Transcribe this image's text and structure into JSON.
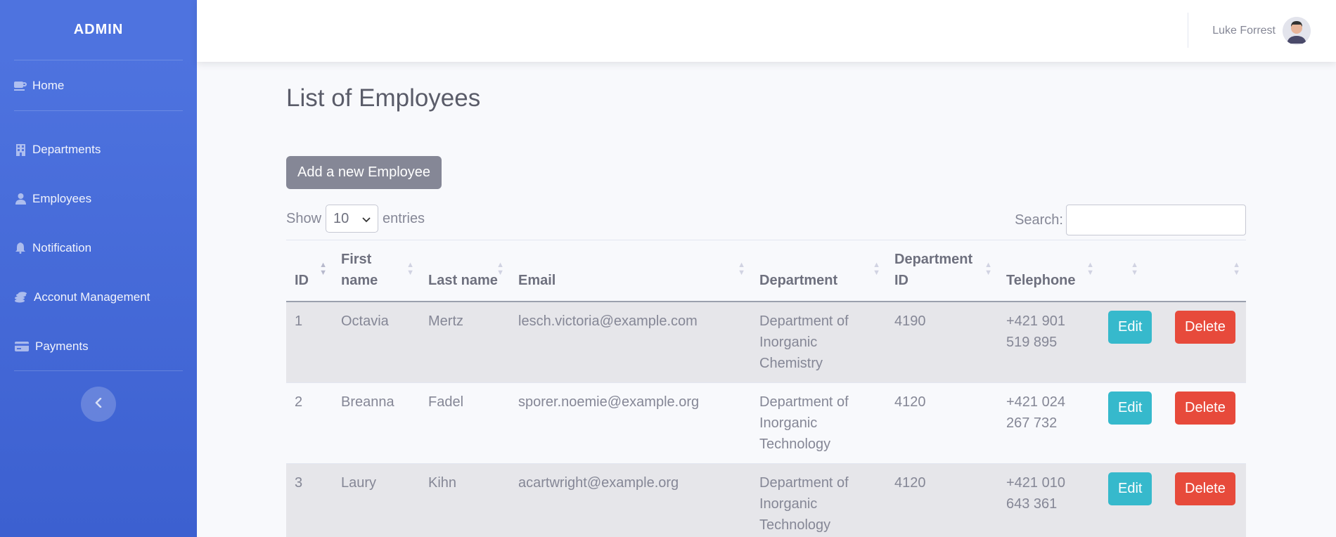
{
  "sidebar": {
    "brand": "ADMIN",
    "items": [
      {
        "label": "Home",
        "icon": "coffee-icon"
      },
      {
        "label": "Departments",
        "icon": "building-icon"
      },
      {
        "label": "Employees",
        "icon": "user-icon"
      },
      {
        "label": "Notification",
        "icon": "bell-icon"
      },
      {
        "label": "Acconut Management",
        "icon": "coins-icon"
      },
      {
        "label": "Payments",
        "icon": "credit-card-icon"
      }
    ],
    "toggle_icon": "chevron-left-icon"
  },
  "topbar": {
    "user_name": "Luke Forrest"
  },
  "main": {
    "title": "List of Employees",
    "add_button": "Add a new Employee",
    "show_label": "Show",
    "entries_value": "10",
    "entries_label": "entries",
    "search_label": "Search:",
    "search_value": ""
  },
  "table": {
    "headers": [
      "ID",
      "First name",
      "Last name",
      "Email",
      "Department",
      "Department ID",
      "Telephone",
      "",
      ""
    ],
    "edit_label": "Edit",
    "delete_label": "Delete",
    "rows": [
      {
        "id": "1",
        "first": "Octavia",
        "last": "Mertz",
        "email": "lesch.victoria@example.com",
        "department": "Department of Inorganic Chemistry",
        "dept_id": "4190",
        "phone": "+421 901 519 895"
      },
      {
        "id": "2",
        "first": "Breanna",
        "last": "Fadel",
        "email": "sporer.noemie@example.org",
        "department": "Department of Inorganic Technology",
        "dept_id": "4120",
        "phone": "+421 024 267 732"
      },
      {
        "id": "3",
        "first": "Laury",
        "last": "Kihn",
        "email": "acartwright@example.org",
        "department": "Department of Inorganic Technology",
        "dept_id": "4120",
        "phone": "+421 010 643 361"
      }
    ]
  },
  "colors": {
    "sidebar": "#4e73df",
    "edit": "#36b9cc",
    "delete": "#e74a3b",
    "add": "#858796"
  }
}
